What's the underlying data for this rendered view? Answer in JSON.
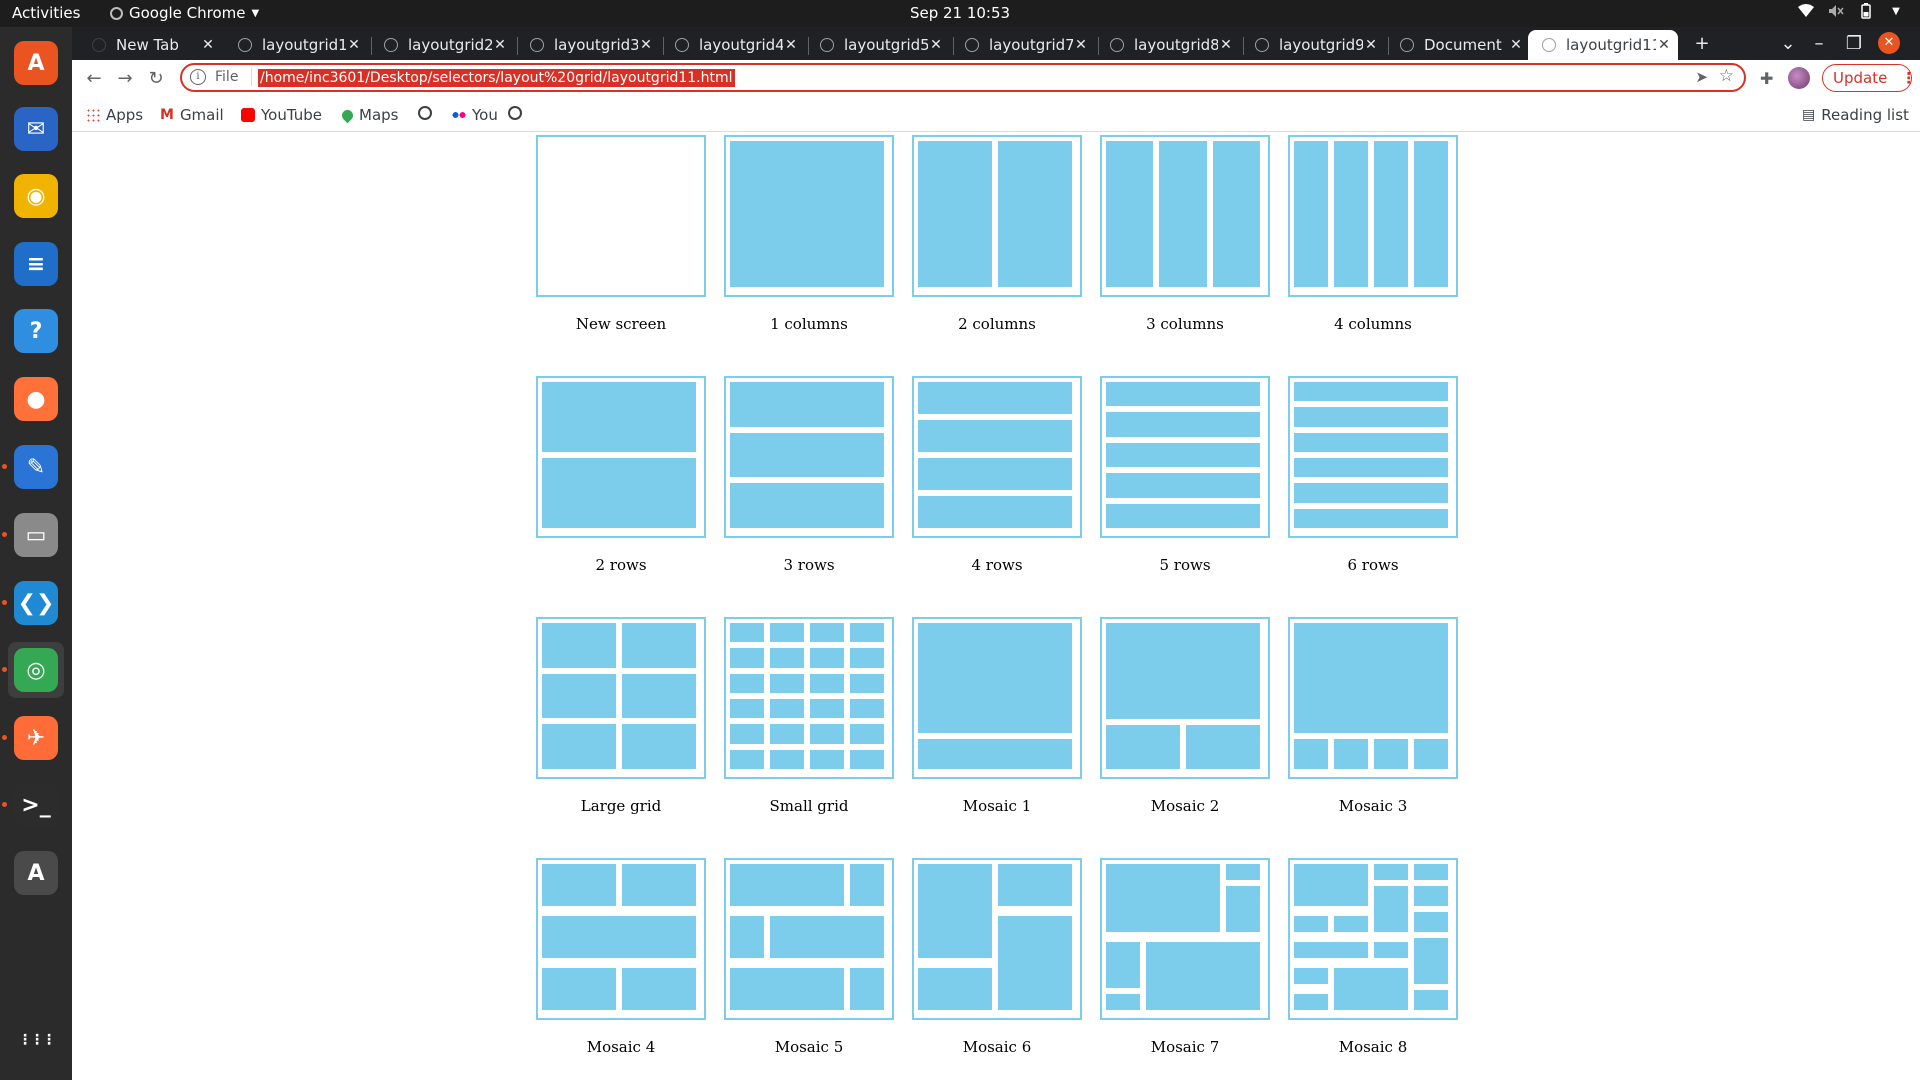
{
  "system": {
    "activities": "Activities",
    "app_menu": "Google Chrome",
    "clock": "Sep 21  10:53",
    "accent": "#e95420"
  },
  "dock": {
    "items": [
      {
        "name": "ubuntu-software-icon",
        "glyph": "A",
        "color": "#e95420"
      },
      {
        "name": "thunderbird-icon",
        "glyph": "✉",
        "color": "#2a64c5"
      },
      {
        "name": "rhythmbox-icon",
        "glyph": "◉",
        "color": "#f0b400"
      },
      {
        "name": "writer-icon",
        "glyph": "≡",
        "color": "#1f6ec9"
      },
      {
        "name": "help-icon",
        "glyph": "?",
        "color": "#2f8ee0"
      },
      {
        "name": "firefox-icon",
        "glyph": "●",
        "color": "#ff7139"
      },
      {
        "name": "text-editor-icon",
        "glyph": "✎",
        "color": "#2a74d6"
      },
      {
        "name": "files-icon",
        "glyph": "▭",
        "color": "#8a8a8a"
      },
      {
        "name": "vscode-icon",
        "glyph": "❮❯",
        "color": "#1f8ad2"
      },
      {
        "name": "chrome-icon",
        "glyph": "◎",
        "color": "#34a853"
      },
      {
        "name": "postman-icon",
        "glyph": "✈",
        "color": "#ff6c37"
      },
      {
        "name": "terminal-icon",
        "glyph": ">_",
        "color": "#2c2c2c"
      },
      {
        "name": "software-updater-icon",
        "glyph": "A",
        "color": "#4a4a4a"
      },
      {
        "name": "show-apps-icon",
        "glyph": "⋮⋮⋮",
        "color": "transparent"
      }
    ]
  },
  "browser": {
    "tabs": [
      {
        "title": "New Tab"
      },
      {
        "title": "layoutgrid1"
      },
      {
        "title": "layoutgrid2"
      },
      {
        "title": "layoutgrid3"
      },
      {
        "title": "layoutgrid4"
      },
      {
        "title": "layoutgrid5"
      },
      {
        "title": "layoutgrid7"
      },
      {
        "title": "layoutgrid8"
      },
      {
        "title": "layoutgrid9"
      },
      {
        "title": "Document"
      },
      {
        "title": "layoutgrid11"
      }
    ],
    "active_tab_index": 10,
    "new_tab": "+",
    "omnibox": {
      "scheme": "File",
      "url": "/home/inc3601/Desktop/selectors/layout%20grid/layoutgrid11.html"
    },
    "update_label": "Update",
    "bookmarks": [
      {
        "label": "Apps",
        "icon": "apps-grid-icon"
      },
      {
        "label": "Gmail",
        "icon": "gmail-icon"
      },
      {
        "label": "YouTube",
        "icon": "youtube-icon"
      },
      {
        "label": "Maps",
        "icon": "maps-icon"
      },
      {
        "label": "",
        "icon": "globe-icon"
      },
      {
        "label": "You",
        "icon": "flickr-icon"
      },
      {
        "label": "",
        "icon": "globe-icon"
      }
    ],
    "reading_list": "Reading list"
  },
  "layouts": {
    "color": "#7bcdeb",
    "items": [
      {
        "label": "New screen"
      },
      {
        "label": "1 columns"
      },
      {
        "label": "2 columns"
      },
      {
        "label": "3 columns"
      },
      {
        "label": "4 columns"
      },
      {
        "label": "2 rows"
      },
      {
        "label": "3 rows"
      },
      {
        "label": "4 rows"
      },
      {
        "label": "5 rows"
      },
      {
        "label": "6 rows"
      },
      {
        "label": "Large grid"
      },
      {
        "label": "Small grid"
      },
      {
        "label": "Mosaic 1"
      },
      {
        "label": "Mosaic 2"
      },
      {
        "label": "Mosaic 3"
      },
      {
        "label": "Mosaic 4"
      },
      {
        "label": "Mosaic 5"
      },
      {
        "label": "Mosaic 6"
      },
      {
        "label": "Mosaic 7"
      },
      {
        "label": "Mosaic 8"
      }
    ]
  }
}
